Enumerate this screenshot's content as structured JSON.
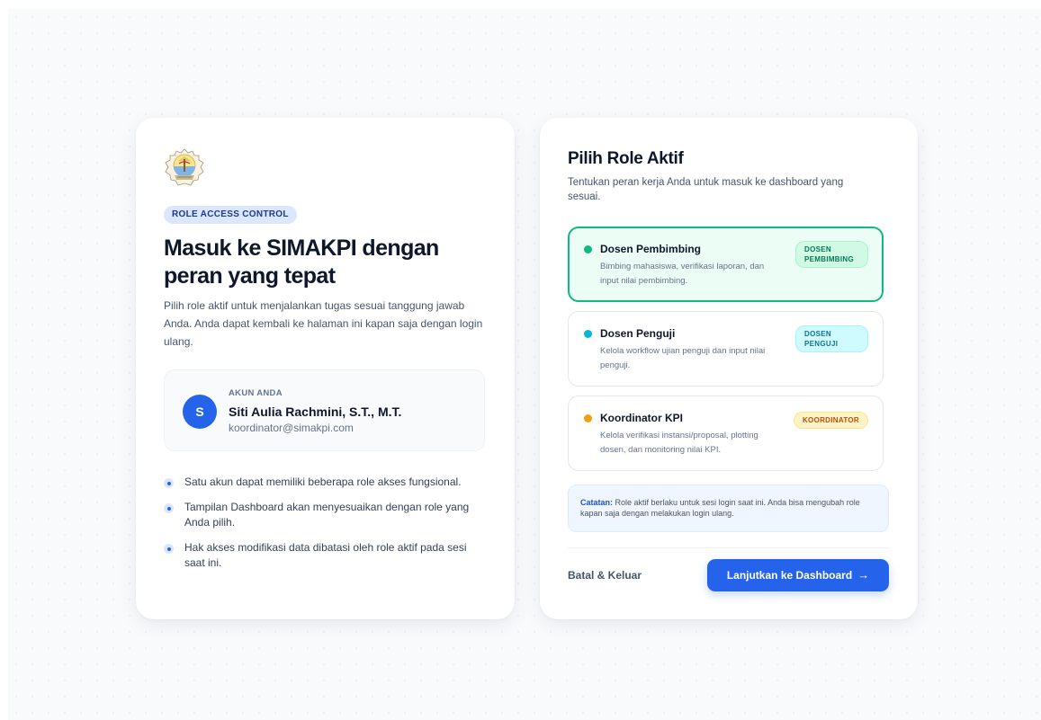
{
  "left": {
    "badge": "ROLE ACCESS CONTROL",
    "title": "Masuk ke SIMAKPI dengan peran yang tepat",
    "description": "Pilih role aktif untuk menjalankan tugas sesuai tanggung jawab Anda. Anda dapat kembali ke halaman ini kapan saja dengan login ulang.",
    "account": {
      "label": "AKUN ANDA",
      "initial": "S",
      "name": "Siti Aulia Rachmini, S.T., M.T.",
      "email": "koordinator@simakpi.com"
    },
    "bullets": [
      "Satu akun dapat memiliki beberapa role akses fungsional.",
      "Tampilan Dashboard akan menyesuaikan dengan role yang Anda pilih.",
      "Hak akses modifikasi data dibatasi oleh role aktif pada sesi saat ini."
    ]
  },
  "right": {
    "title": "Pilih Role Aktif",
    "subtitle": "Tentukan peran kerja Anda untuk masuk ke dashboard yang sesuai.",
    "roles": [
      {
        "name": "Dosen Pembimbing",
        "desc": "Bimbing mahasiswa, verifikasi laporan, dan input nilai pembimbing.",
        "tag": "DOSEN PEMBIMBING",
        "dot_color": "#10b981",
        "selected": true
      },
      {
        "name": "Dosen Penguji",
        "desc": "Kelola workflow ujian penguji dan input nilai penguji.",
        "tag": "DOSEN PENGUJI",
        "dot_color": "#06b6d4",
        "selected": false
      },
      {
        "name": "Koordinator KPI",
        "desc": "Kelola verifikasi instansi/proposal, plotting dosen, dan monitoring nilai KPI.",
        "tag": "KOORDINATOR",
        "dot_color": "#f59e0b",
        "selected": false
      }
    ],
    "note_label": "Catatan:",
    "note_text": "Role aktif berlaku untuk sesi login saat ini. Anda bisa mengubah role kapan saja dengan melakukan login ulang.",
    "cancel_label": "Batal & Keluar",
    "continue_label": "Lanjutkan ke Dashboard",
    "continue_arrow": "→"
  },
  "colors": {
    "primary": "#2563eb",
    "success": "#10b981",
    "info": "#06b6d4",
    "warning": "#f59e0b"
  }
}
